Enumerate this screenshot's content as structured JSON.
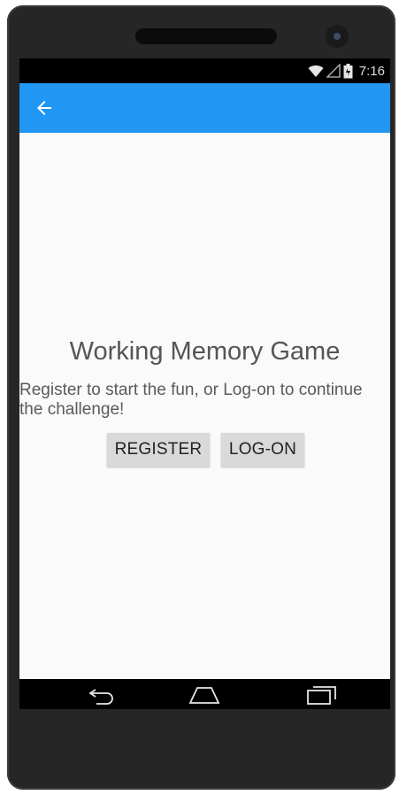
{
  "status_bar": {
    "time": "7:16",
    "icons": [
      "wifi-icon",
      "signal-icon",
      "battery-icon"
    ]
  },
  "app_bar": {
    "color": "#2196f3",
    "back_icon": "arrow-back-icon"
  },
  "main": {
    "title": "Working Memory Game",
    "subtitle": "Register to start the fun, or Log-on to continue the challenge!",
    "register_label": "REGISTER",
    "logon_label": "LOG-ON"
  },
  "nav_bar": {
    "icons": [
      "nav-back-icon",
      "nav-home-icon",
      "nav-recent-apps-icon"
    ]
  }
}
